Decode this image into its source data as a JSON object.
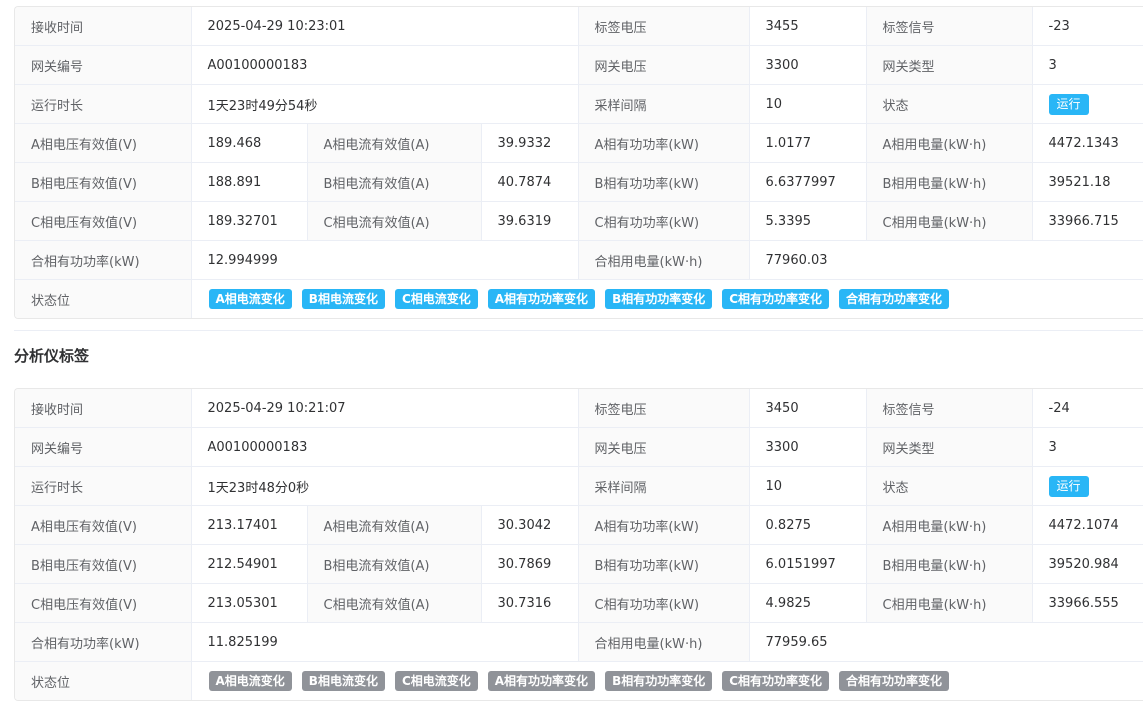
{
  "colors": {
    "run_tag": "#29b6f6",
    "flag_active": "#29b6f6",
    "flag_inactive": "#909399"
  },
  "records": [
    {
      "receive_time_label": "接收时间",
      "receive_time": "2025-04-29 10:23:01",
      "tag_voltage_label": "标签电压",
      "tag_voltage": "3455",
      "tag_signal_label": "标签信号",
      "tag_signal": "-23",
      "gateway_id_label": "网关编号",
      "gateway_id": "A00100000183",
      "gateway_voltage_label": "网关电压",
      "gateway_voltage": "3300",
      "gateway_type_label": "网关类型",
      "gateway_type": "3",
      "uptime_label": "运行时长",
      "uptime": "1天23时49分54秒",
      "sample_interval_label": "采样间隔",
      "sample_interval": "10",
      "status_label": "状态",
      "status": "运行",
      "a_voltage_label": "A相电压有效值(V)",
      "a_voltage": "189.468",
      "a_current_label": "A相电流有效值(A)",
      "a_current": "39.9332",
      "a_power_label": "A相有功功率(kW)",
      "a_power": "1.0177",
      "a_energy_label": "A相用电量(kW·h)",
      "a_energy": "4472.1343",
      "b_voltage_label": "B相电压有效值(V)",
      "b_voltage": "188.891",
      "b_current_label": "B相电流有效值(A)",
      "b_current": "40.7874",
      "b_power_label": "B相有功功率(kW)",
      "b_power": "6.6377997",
      "b_energy_label": "B相用电量(kW·h)",
      "b_energy": "39521.18",
      "c_voltage_label": "C相电压有效值(V)",
      "c_voltage": "189.32701",
      "c_current_label": "C相电流有效值(A)",
      "c_current": "39.6319",
      "c_power_label": "C相有功功率(kW)",
      "c_power": "5.3395",
      "c_energy_label": "C相用电量(kW·h)",
      "c_energy": "33966.715",
      "total_power_label": "合相有功功率(kW)",
      "total_power": "12.994999",
      "total_energy_label": "合相用电量(kW·h)",
      "total_energy": "77960.03",
      "status_bits_label": "状态位",
      "flags": [
        {
          "label": "A相电流变化",
          "active": true
        },
        {
          "label": "B相电流变化",
          "active": true
        },
        {
          "label": "C相电流变化",
          "active": true
        },
        {
          "label": "A相有功功率变化",
          "active": true
        },
        {
          "label": "B相有功功率变化",
          "active": true
        },
        {
          "label": "C相有功功率变化",
          "active": true
        },
        {
          "label": "合相有功功率变化",
          "active": true
        }
      ]
    },
    {
      "receive_time_label": "接收时间",
      "receive_time": "2025-04-29 10:21:07",
      "tag_voltage_label": "标签电压",
      "tag_voltage": "3450",
      "tag_signal_label": "标签信号",
      "tag_signal": "-24",
      "gateway_id_label": "网关编号",
      "gateway_id": "A00100000183",
      "gateway_voltage_label": "网关电压",
      "gateway_voltage": "3300",
      "gateway_type_label": "网关类型",
      "gateway_type": "3",
      "uptime_label": "运行时长",
      "uptime": "1天23时48分0秒",
      "sample_interval_label": "采样间隔",
      "sample_interval": "10",
      "status_label": "状态",
      "status": "运行",
      "a_voltage_label": "A相电压有效值(V)",
      "a_voltage": "213.17401",
      "a_current_label": "A相电流有效值(A)",
      "a_current": "30.3042",
      "a_power_label": "A相有功功率(kW)",
      "a_power": "0.8275",
      "a_energy_label": "A相用电量(kW·h)",
      "a_energy": "4472.1074",
      "b_voltage_label": "B相电压有效值(V)",
      "b_voltage": "212.54901",
      "b_current_label": "B相电流有效值(A)",
      "b_current": "30.7869",
      "b_power_label": "B相有功功率(kW)",
      "b_power": "6.0151997",
      "b_energy_label": "B相用电量(kW·h)",
      "b_energy": "39520.984",
      "c_voltage_label": "C相电压有效值(V)",
      "c_voltage": "213.05301",
      "c_current_label": "C相电流有效值(A)",
      "c_current": "30.7316",
      "c_power_label": "C相有功功率(kW)",
      "c_power": "4.9825",
      "c_energy_label": "C相用电量(kW·h)",
      "c_energy": "33966.555",
      "total_power_label": "合相有功功率(kW)",
      "total_power": "11.825199",
      "total_energy_label": "合相用电量(kW·h)",
      "total_energy": "77959.65",
      "status_bits_label": "状态位",
      "flags": [
        {
          "label": "A相电流变化",
          "active": false
        },
        {
          "label": "B相电流变化",
          "active": false
        },
        {
          "label": "C相电流变化",
          "active": false
        },
        {
          "label": "A相有功功率变化",
          "active": false
        },
        {
          "label": "B相有功功率变化",
          "active": false
        },
        {
          "label": "C相有功功率变化",
          "active": false
        },
        {
          "label": "合相有功功率变化",
          "active": false
        }
      ]
    }
  ],
  "section_title": "分析仪标签"
}
